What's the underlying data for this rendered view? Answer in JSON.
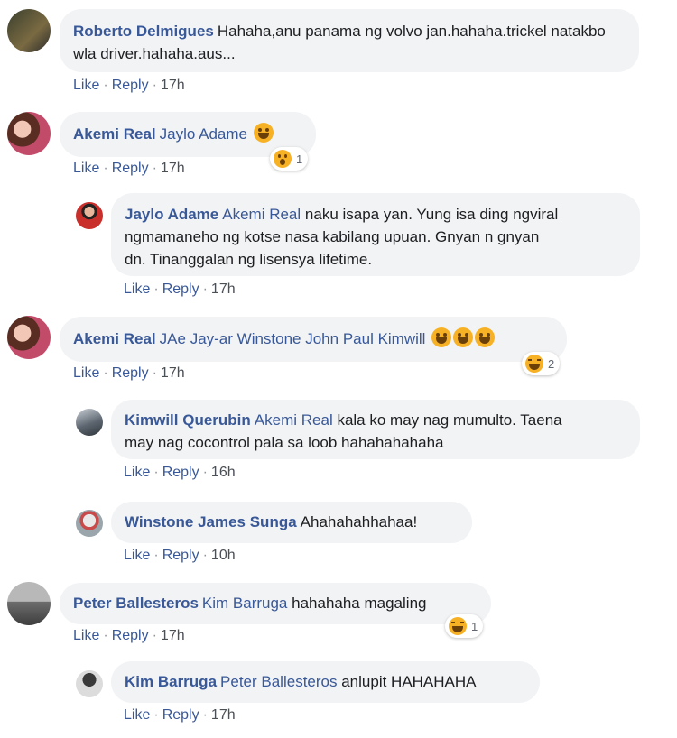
{
  "action_labels": {
    "like": "Like",
    "reply": "Reply",
    "separator": "·"
  },
  "comments": [
    {
      "author": "Roberto Delmigues",
      "text": "Hahaha,anu panama ng volvo jan.hahaha.trickel natakbo wla driver.hahaha.aus...",
      "time": "17h"
    },
    {
      "author": "Akemi Real",
      "mention": "Jaylo Adame",
      "emoji": [
        "laughing-tears-emoji"
      ],
      "time": "17h",
      "reaction": {
        "icon": "wow-reaction-icon",
        "count": "1"
      }
    },
    {
      "author": "Jaylo Adame",
      "mention": "Akemi Real",
      "text_line1": "naku isapa yan. Yung isa ding ngviral",
      "text_line2": "ngmamaneho ng kotse nasa kabilang upuan. Gnyan n gnyan",
      "text_line3": "dn. Tinanggalan ng lisensya lifetime.",
      "time": "17h"
    },
    {
      "author": "Akemi Real",
      "mention": "JAe Jay-ar Winstone John Paul Kimwill",
      "emoji": [
        "laughing-tears-emoji",
        "laughing-tears-emoji",
        "laughing-tears-emoji"
      ],
      "time": "17h",
      "reaction": {
        "icon": "haha-reaction-icon",
        "count": "2"
      }
    },
    {
      "author": "Kimwill Querubin",
      "mention": "Akemi Real",
      "text_line1": "kala ko may nag mumulto. Taena",
      "text_line2": "may nag cocontrol pala sa loob hahahahahaha",
      "time": "16h"
    },
    {
      "author": "Winstone James Sunga",
      "text": "Ahahahahhahaa!",
      "time": "10h"
    },
    {
      "author": "Peter Ballesteros",
      "mention": "Kim Barruga",
      "text": "hahahaha magaling",
      "time": "17h",
      "reaction": {
        "icon": "haha-reaction-icon",
        "count": "1"
      }
    },
    {
      "author": "Kim Barruga",
      "mention": "Peter Ballesteros",
      "text": "anlupit HAHAHAHA",
      "time": "17h"
    }
  ]
}
